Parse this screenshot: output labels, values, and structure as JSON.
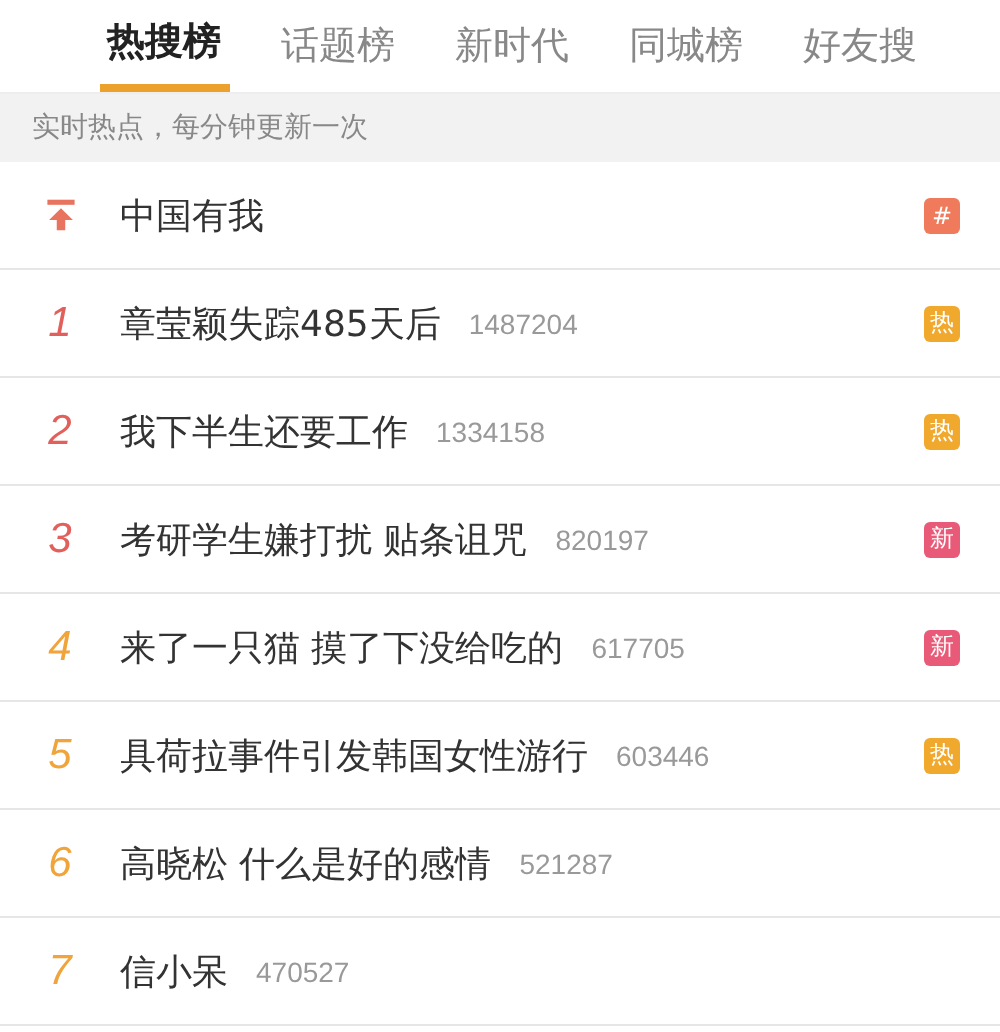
{
  "tabs": [
    {
      "label": "热搜榜",
      "selected": true
    },
    {
      "label": "话题榜",
      "selected": false
    },
    {
      "label": "新时代",
      "selected": false
    },
    {
      "label": "同城榜",
      "selected": false
    },
    {
      "label": "好友搜",
      "selected": false
    }
  ],
  "subtitle": "实时热点，每分钟更新一次",
  "items": [
    {
      "kind": "pinned",
      "color": "#e8735f",
      "title": "中国有我",
      "badge": {
        "text": "#",
        "color": "#f07a5c"
      }
    },
    {
      "kind": "ranked",
      "rank": "1",
      "color": "#e2605c",
      "title": "章莹颖失踪485天后",
      "count": "1487204",
      "badge": {
        "text": "热",
        "color": "#f0a92c"
      }
    },
    {
      "kind": "ranked",
      "rank": "2",
      "color": "#e2605c",
      "title": "我下半生还要工作",
      "count": "1334158",
      "badge": {
        "text": "热",
        "color": "#f0a92c"
      }
    },
    {
      "kind": "ranked",
      "rank": "3",
      "color": "#e2605c",
      "title": "考研学生嫌打扰 贴条诅咒",
      "count": "820197",
      "badge": {
        "text": "新",
        "color": "#e85a78"
      }
    },
    {
      "kind": "ranked",
      "rank": "4",
      "color": "#f0a43a",
      "title": "来了一只猫 摸了下没给吃的",
      "count": "617705",
      "badge": {
        "text": "新",
        "color": "#e85a78"
      }
    },
    {
      "kind": "ranked",
      "rank": "5",
      "color": "#f0a43a",
      "title": "具荷拉事件引发韩国女性游行",
      "count": "603446",
      "badge": {
        "text": "热",
        "color": "#f0a92c"
      }
    },
    {
      "kind": "ranked",
      "rank": "6",
      "color": "#f0a43a",
      "title": "高晓松 什么是好的感情",
      "count": "521287"
    },
    {
      "kind": "ranked",
      "rank": "7",
      "color": "#f0a43a",
      "title": "信小呆",
      "count": "470527"
    }
  ]
}
